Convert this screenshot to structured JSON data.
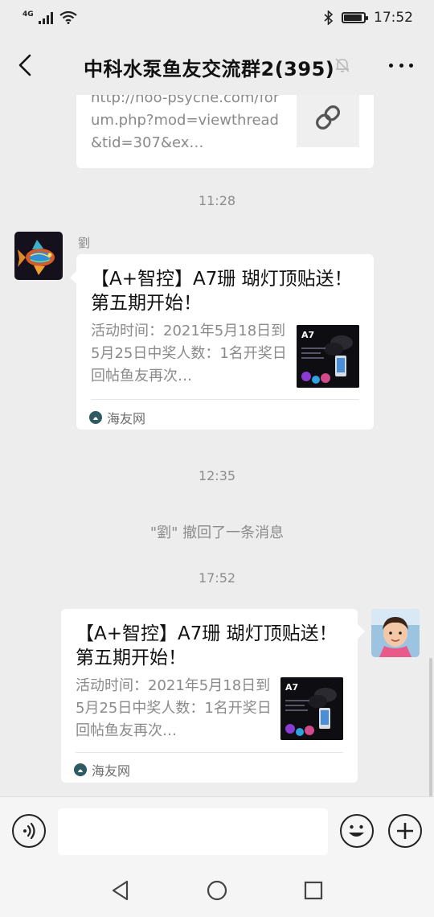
{
  "status_bar": {
    "network": "4G",
    "time": "17:52",
    "battery_level": 0.9
  },
  "header": {
    "title": "中科水泵鱼友交流群2(395)",
    "icons": [
      "back-arrow-icon",
      "mute-bell-icon",
      "more-icon"
    ]
  },
  "messages": {
    "prev_link": {
      "text": "http://noo-psyche.com/forum.php?mod=viewthread&tid=307&ex…",
      "icon": "link-icon"
    },
    "time1": "11:28",
    "msg1": {
      "sender": "劉",
      "title": "【A+智控】A7珊 瑚灯顶贴送！第五期开始！",
      "description": "活动时间：2021年5月18日到5月25日中奖人数：1名开奖日回帖鱼友再次…",
      "thumb_label": "A7",
      "source": "海友网"
    },
    "time2": "12:35",
    "recall_notice": "\"劉\" 撤回了一条消息",
    "time3": "17:52",
    "msg2": {
      "title": "【A+智控】A7珊 瑚灯顶贴送！第五期开始！",
      "description": "活动时间：2021年5月18日到5月25日中奖人数：1名开奖日回帖鱼友再次…",
      "thumb_label": "A7",
      "source": "海友网"
    }
  },
  "input_bar": {
    "placeholder": "",
    "icons": [
      "voice-icon",
      "emoji-icon",
      "plus-icon"
    ]
  },
  "system_nav": {
    "icons": [
      "back-triangle-icon",
      "home-circle-icon",
      "recents-square-icon"
    ]
  }
}
